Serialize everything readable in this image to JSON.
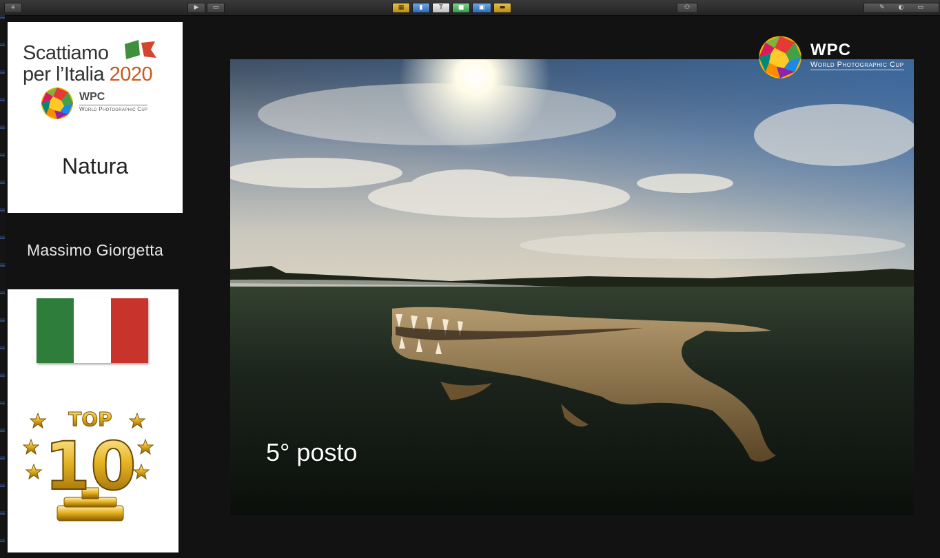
{
  "toolbar": {
    "left_button": "+",
    "play_icon": "play-icon",
    "display_icon": "display-icon"
  },
  "logo_panel": {
    "title_line1": "Scattiamo",
    "title_line2_prefix": "per l’Italia ",
    "title_year": "2020",
    "wpc_short": "WPC",
    "wpc_long": "World Photographic Cup",
    "category": "Natura"
  },
  "author": "Massimo Giorgetta",
  "award": {
    "flag_colors": [
      "#2e7d3a",
      "#ffffff",
      "#c8332b"
    ],
    "top_label": "TOP",
    "rank_label": "10"
  },
  "photo": {
    "place": "5° posto"
  },
  "corner_logo": {
    "wpc_short": "WPC",
    "wpc_long": "World Photographic Cup"
  }
}
